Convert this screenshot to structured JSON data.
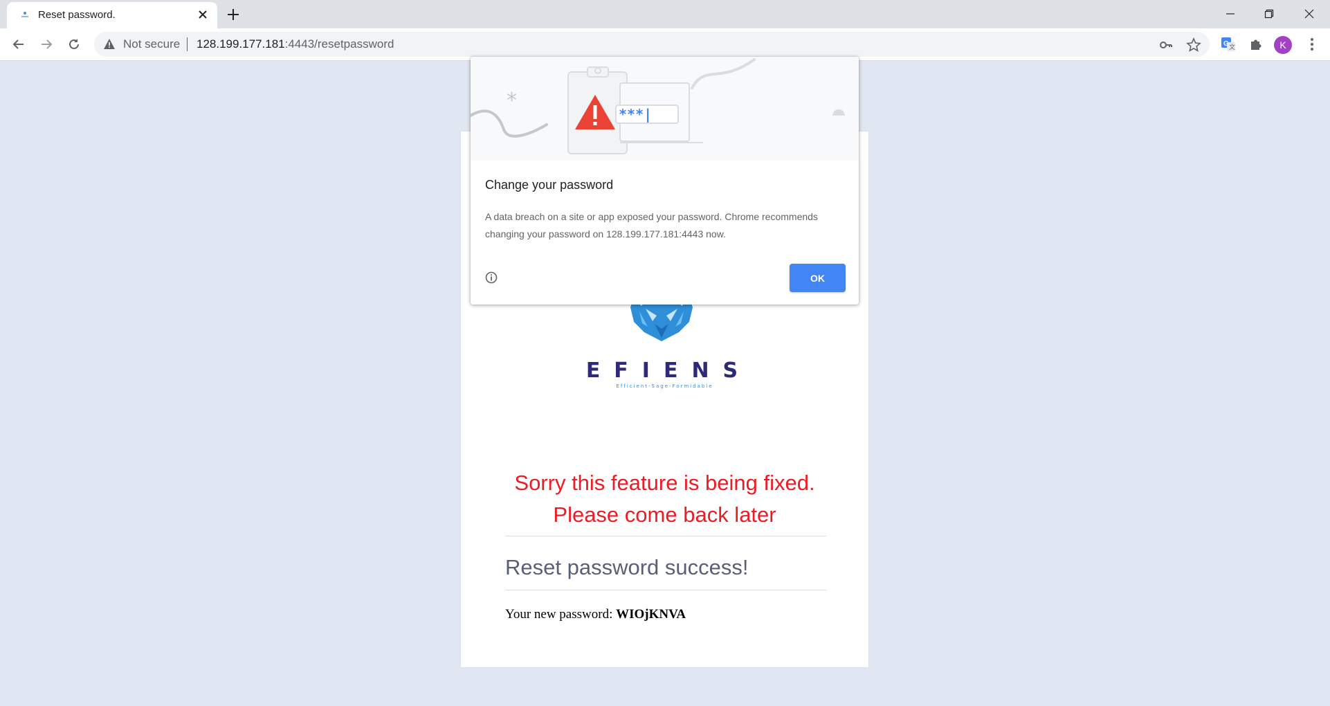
{
  "browser": {
    "tab_title": "Reset password.",
    "not_secure_label": "Not secure",
    "url_host": "128.199.177.181",
    "url_rest": ":4443/resetpassword",
    "profile_initial": "K"
  },
  "dialog": {
    "title": "Change your password",
    "body_line1": "A data breach on a site or app exposed your password. Chrome recommends",
    "body_line2": "changing your password on 128.199.177.181:4443 now.",
    "ok_label": "OK",
    "illustration_text": "***|"
  },
  "page": {
    "logo_text": "EFIENS",
    "logo_tagline": "Efficient-Sage-Formidable",
    "sorry_line1": "Sorry this feature is being fixed.",
    "sorry_line2": "Please come back later",
    "success_heading": "Reset password success!",
    "new_password_label": "Your new password:",
    "new_password_value": "WIOjKNVA"
  },
  "colors": {
    "background": "#e1e7f2",
    "error_red": "#ec1b24",
    "ok_blue": "#4285f4",
    "logo_navy": "#2d2a78",
    "logo_blue": "#2b8fd6"
  }
}
